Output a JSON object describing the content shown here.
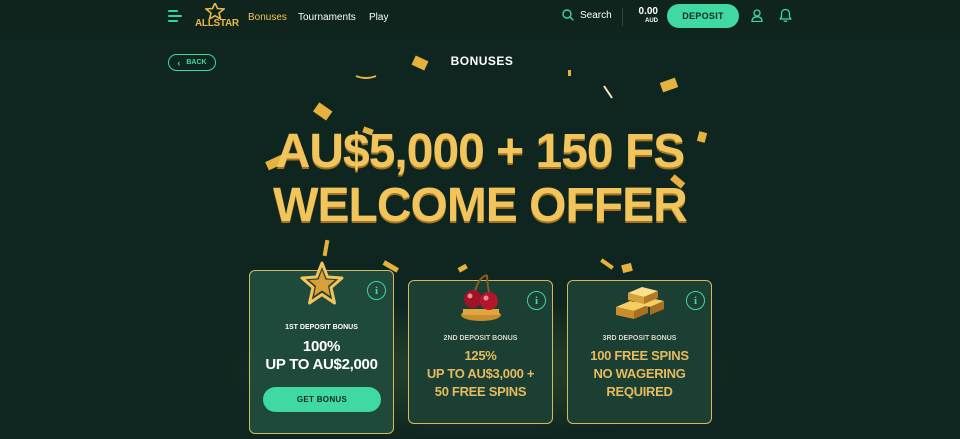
{
  "header": {
    "logo_text": "ALLSTAR",
    "nav": [
      {
        "label": "Bonuses",
        "active": true
      },
      {
        "label": "Tournaments",
        "active": false
      },
      {
        "label": "Play",
        "active": false
      }
    ],
    "search_label": "Search",
    "balance_amount": "0.00",
    "balance_currency": "AUD",
    "deposit_label": "DEPOSIT",
    "icons": [
      "menu-icon",
      "search-icon",
      "user-icon",
      "bell-icon"
    ]
  },
  "page": {
    "back_label": "BACK",
    "title": "BONUSES",
    "hero_line1": "AU$5,000 + 150 FS",
    "hero_line2": "WELCOME OFFER"
  },
  "cards": [
    {
      "label": "1ST DEPOSIT BONUS",
      "line1": "100%",
      "line2": "UP TO AU$2,000",
      "button": "GET BONUS",
      "art": "star"
    },
    {
      "label": "2ND DEPOSIT BONUS",
      "line1": "125%",
      "line2": "UP TO AU$3,000 +",
      "line3": "50 FREE SPINS",
      "art": "cherries"
    },
    {
      "label": "3RD DEPOSIT BONUS",
      "line1": "100 FREE SPINS",
      "line2": "NO WAGERING",
      "line3": "REQUIRED",
      "art": "gold-bars"
    }
  ],
  "colors": {
    "background": "#0f2620",
    "accent_green": "#3fd9a1",
    "gold": "#f2c45c",
    "active_nav": "#f4c15b",
    "card_border": "#d6b95c"
  }
}
